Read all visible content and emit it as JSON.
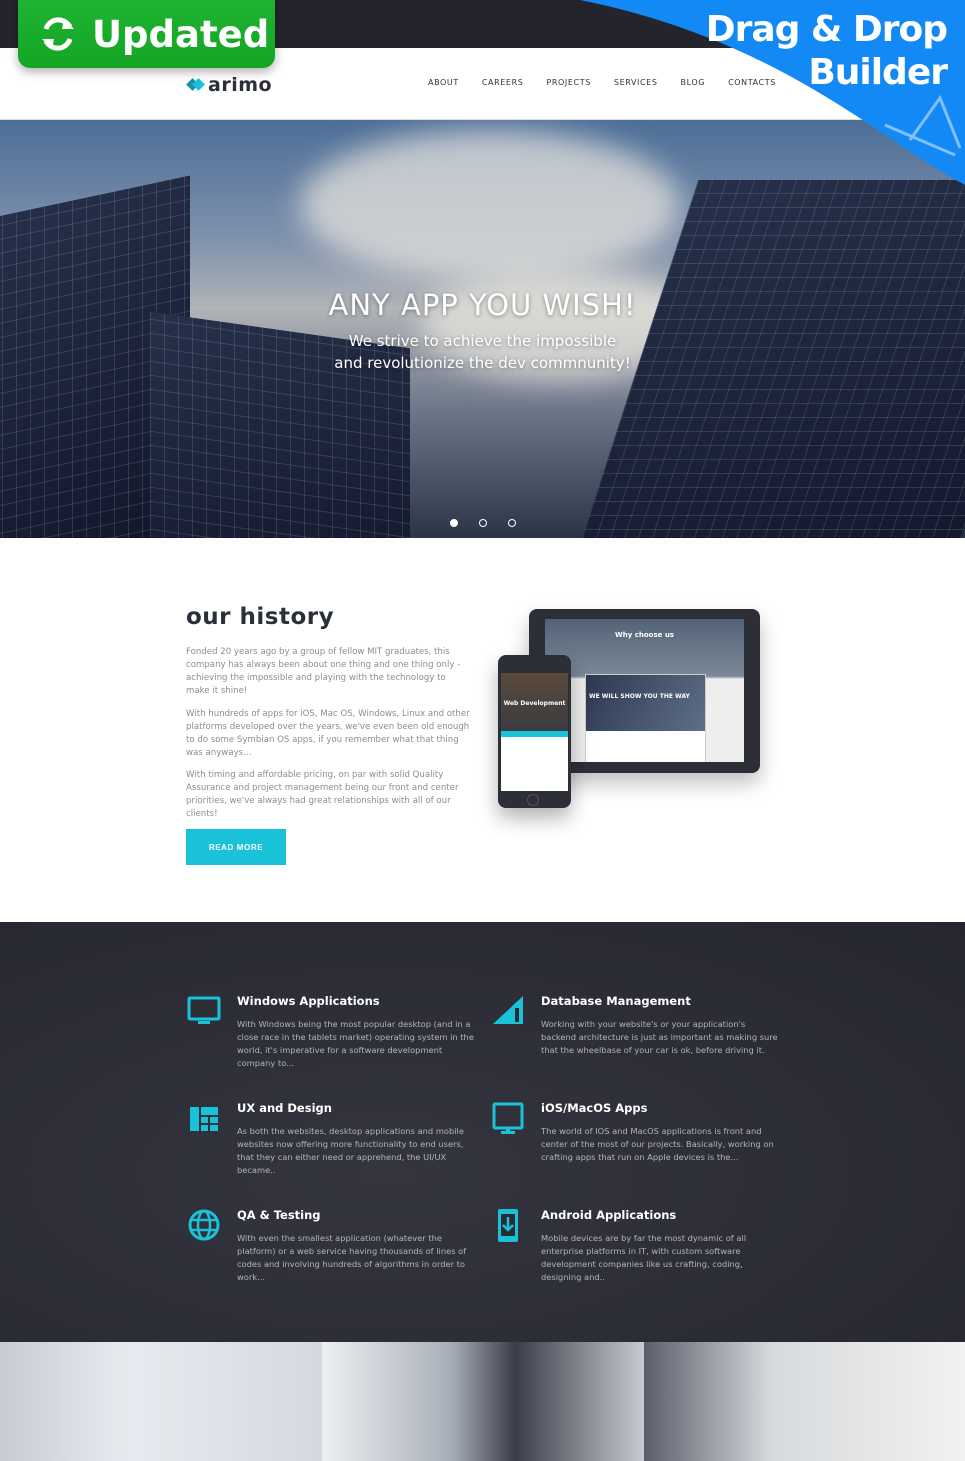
{
  "badges": {
    "updated": "Updated",
    "builder_line1": "Drag & Drop",
    "builder_line2": "Builder"
  },
  "brand": {
    "name": "arimo",
    "accent": "#19c1d9",
    "accent_dark": "#1a8fa8",
    "dark_bg": "#2a2b33"
  },
  "nav": [
    "ABOUT",
    "CAREERS",
    "PROJECTS",
    "SERVICES",
    "BLOG",
    "CONTACTS"
  ],
  "hero": {
    "title": "ANY APP YOU WISH!",
    "subtitle_line1": "We strive to achieve the impossible",
    "subtitle_line2": "and revolutionize the dev commnunity!",
    "slides": 3,
    "active_slide": 1
  },
  "history": {
    "title": "our history",
    "paragraphs": [
      "Fonded 20 years ago by a group of fellow MIT graduates, this company has always been about one thing and one thing only - achieving the impossible and playing with the technology to make it shine!",
      "With hundreds of apps for iOS, Mac OS, Windows, Linux and other platforms developed over the years, we've even been old enough to do some Symbian OS apps, if you remember what that thing was anyways...",
      "With timing and affordable pricing, on par with solid Quality Assurance and project management being our front and center priorities, we've always had great relationships with all of our clients!"
    ],
    "button": "READ MORE",
    "mockup": {
      "tablet_heading": "Why choose us",
      "tablet_inner": "WE WILL SHOW YOU THE WAY",
      "phone_heading": "Web Development"
    }
  },
  "services": [
    {
      "icon": "monitor-icon",
      "title": "Windows Applications",
      "text": "With Windows being the most popular desktop (and in a close race in the tablets market) operating system in the world, it's imperative for a software development company to..."
    },
    {
      "icon": "signal-triangle-icon",
      "title": "Database Management",
      "text": "Working with your website's or your application's backend architecture is just as important as making sure that the wheelbase of your car is ok, before driving it."
    },
    {
      "icon": "layout-grid-icon",
      "title": "UX and Design",
      "text": "As both the websites, desktop applications and mobile websites now offering more functionality to end users, that they can either need or apprehend, the UI/UX became.."
    },
    {
      "icon": "monitor-icon",
      "title": "iOS/MacOS Apps",
      "text": "The world of IOS and MacOS applications is front and center of the most of our projects. Basically, working on crafting apps that run on Apple devices is the..."
    },
    {
      "icon": "globe-icon",
      "title": "QA & Testing",
      "text": "With even the smallest application (whatever the platform) or a web service having thousands of lines of codes and involving hundreds of algorithms in order to work..."
    },
    {
      "icon": "phone-download-icon",
      "title": "Android Applications",
      "text": "Mobile devices are by far the most dynamic of all enterprise platforms in IT, with custom software development companies like us crafting, coding, designing and.."
    }
  ]
}
